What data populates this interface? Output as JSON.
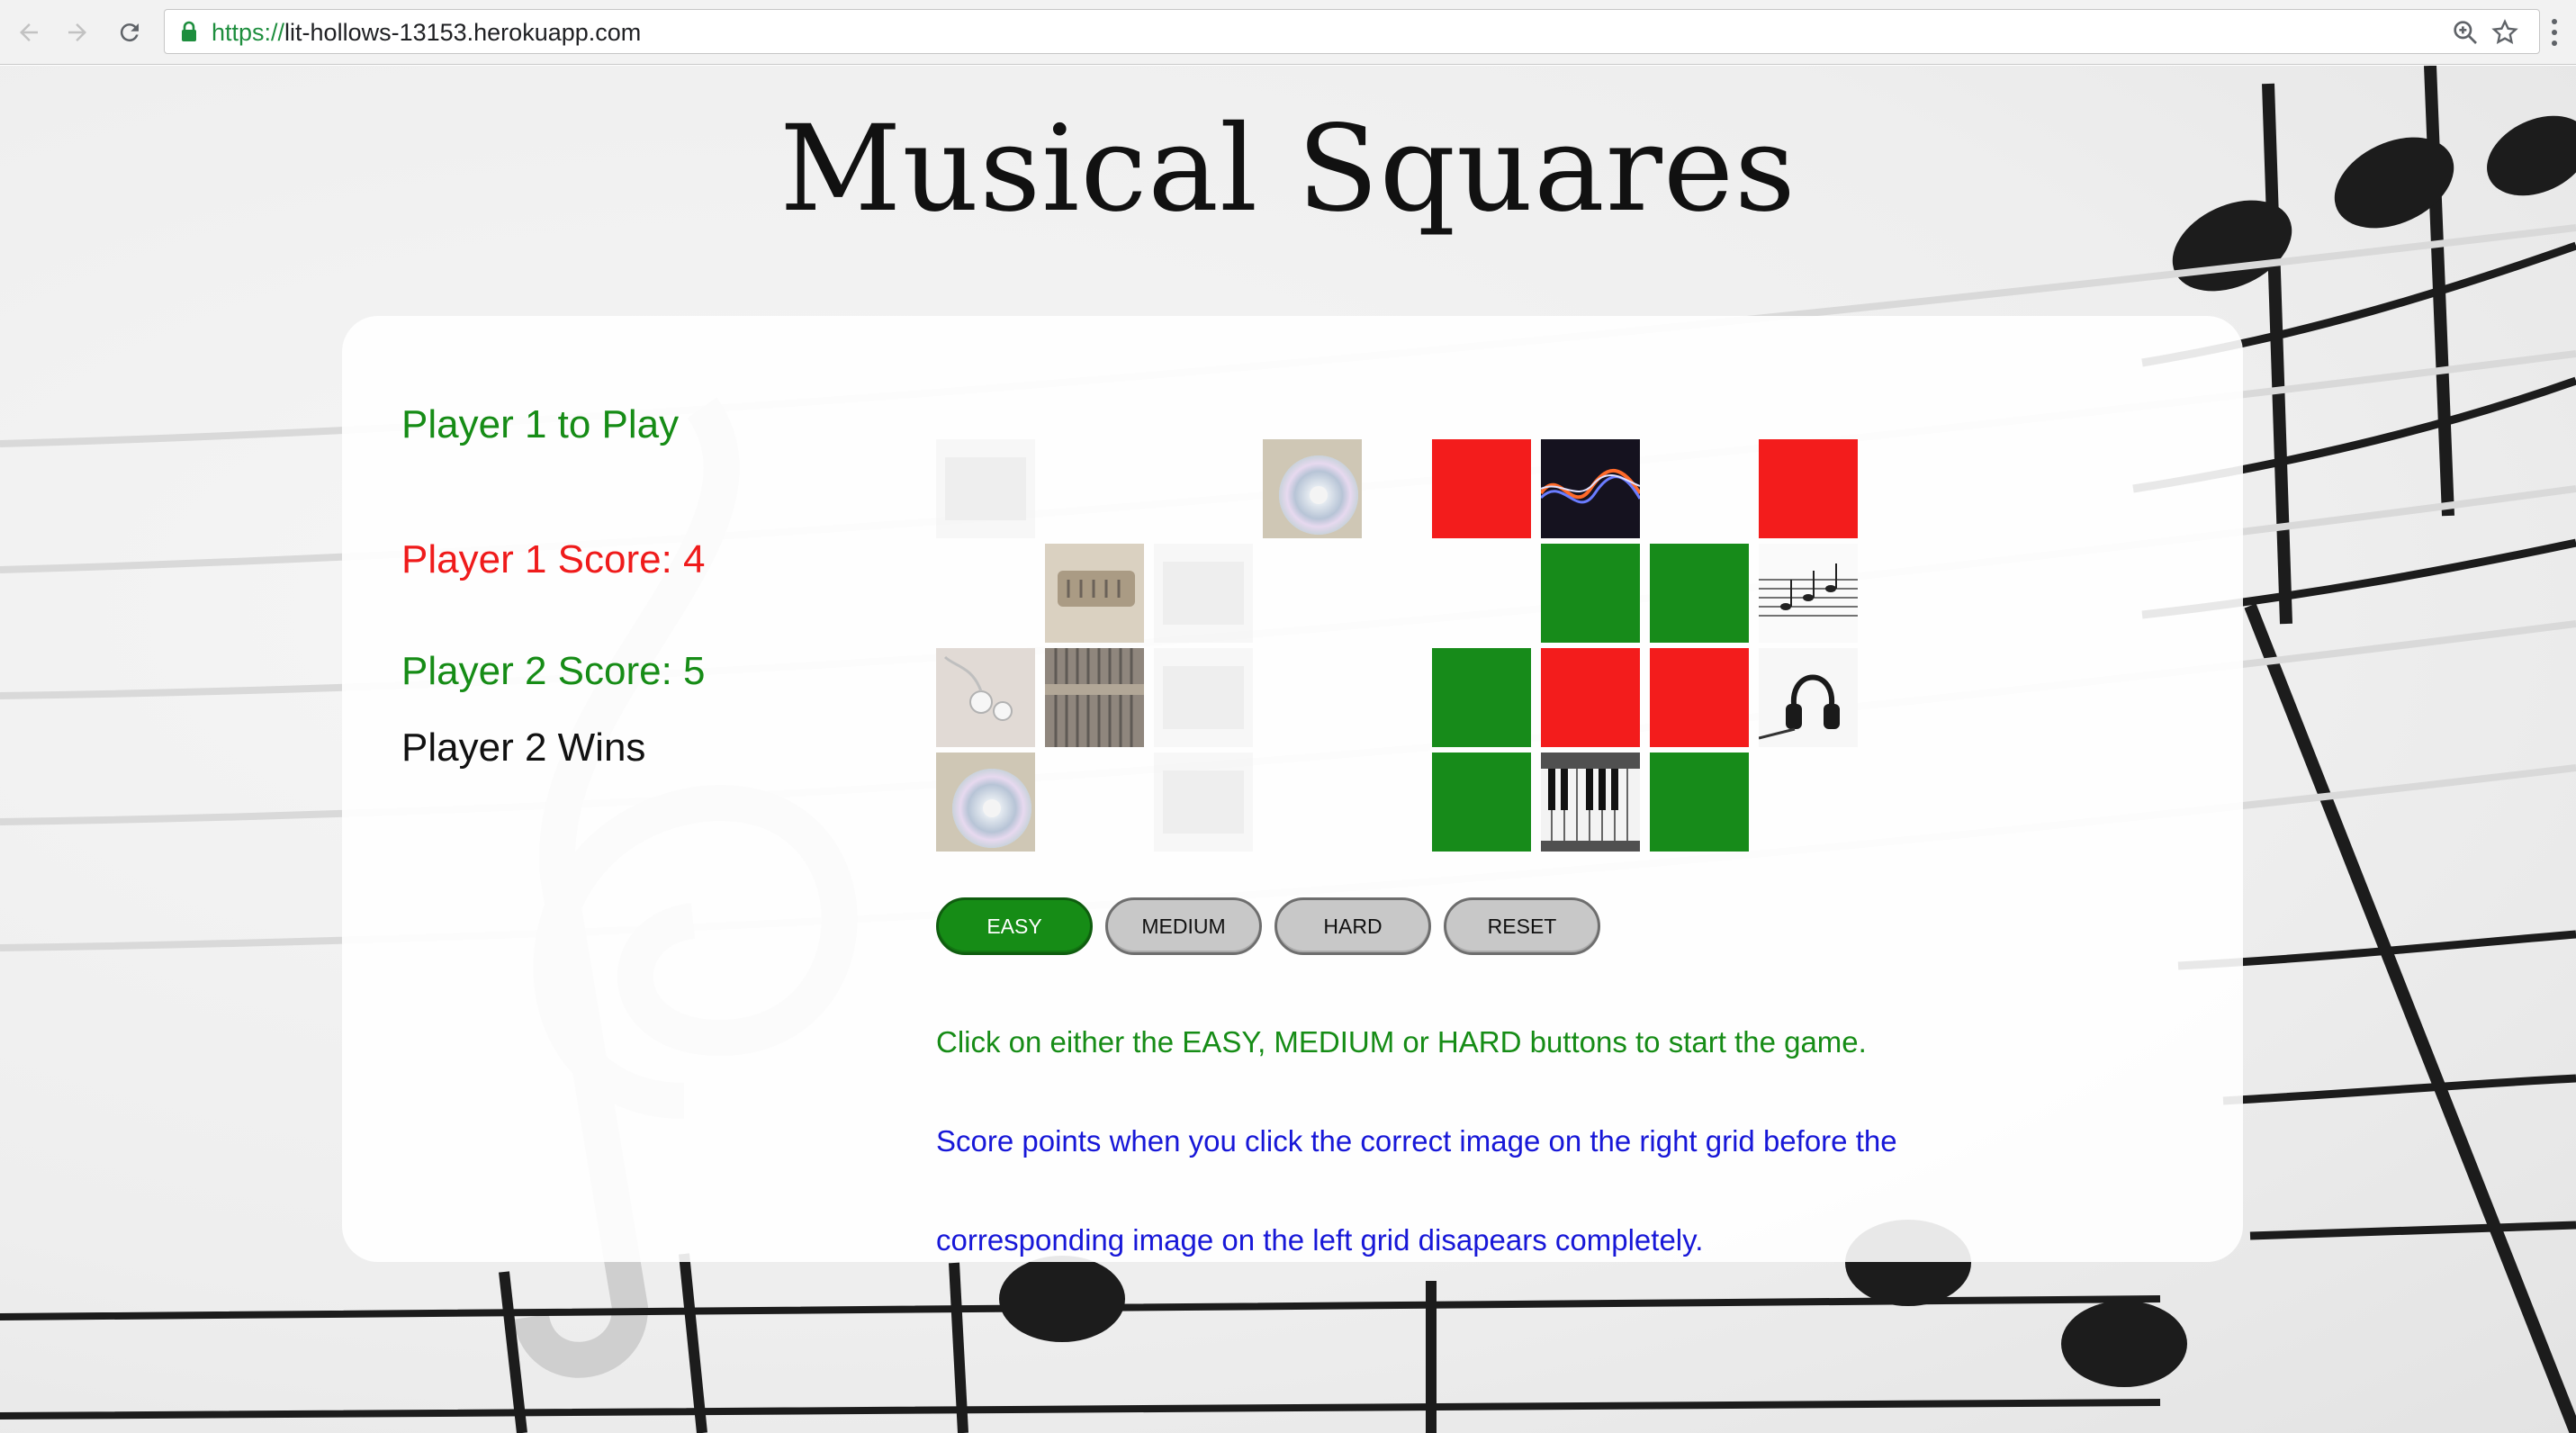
{
  "browser": {
    "url_scheme": "https://",
    "url_host": "lit-hollows-13153.herokuapp.com"
  },
  "page": {
    "title": "Musical Squares"
  },
  "status": {
    "turn": "Player 1 to Play",
    "player1_score": "Player 1 Score: 4",
    "player2_score": "Player 2 Score: 5",
    "result": "Player 2 Wins"
  },
  "left_grid": [
    [
      "faded-image",
      "empty",
      "empty",
      "cd-image"
    ],
    [
      "empty",
      "harmonica-image",
      "faded-image",
      "empty"
    ],
    [
      "earphones-image",
      "piano-strings-image",
      "faded-image",
      "empty"
    ],
    [
      "cd-image",
      "empty",
      "faded-image",
      "empty"
    ]
  ],
  "right_grid": [
    [
      "red",
      "sound-wave-image",
      "empty",
      "red"
    ],
    [
      "empty",
      "green",
      "green",
      "sheet-music-image"
    ],
    [
      "green",
      "red",
      "red",
      "headphones-image"
    ],
    [
      "green",
      "keyboard-image",
      "green",
      "empty"
    ]
  ],
  "buttons": {
    "easy": "EASY",
    "medium": "MEDIUM",
    "hard": "HARD",
    "reset": "RESET",
    "active": "easy"
  },
  "instructions": {
    "line1": "Click on either the EASY, MEDIUM or HARD buttons to start the game.",
    "line2": "Score points when you click the correct image on the right grid before the",
    "line3": "corresponding image on the left grid disapears completely."
  },
  "colors": {
    "correct": "#178b1a",
    "wrong": "#f31c1c",
    "player1": "#ef1b1b",
    "player2": "#168c16",
    "info_blue": "#1717d8"
  }
}
